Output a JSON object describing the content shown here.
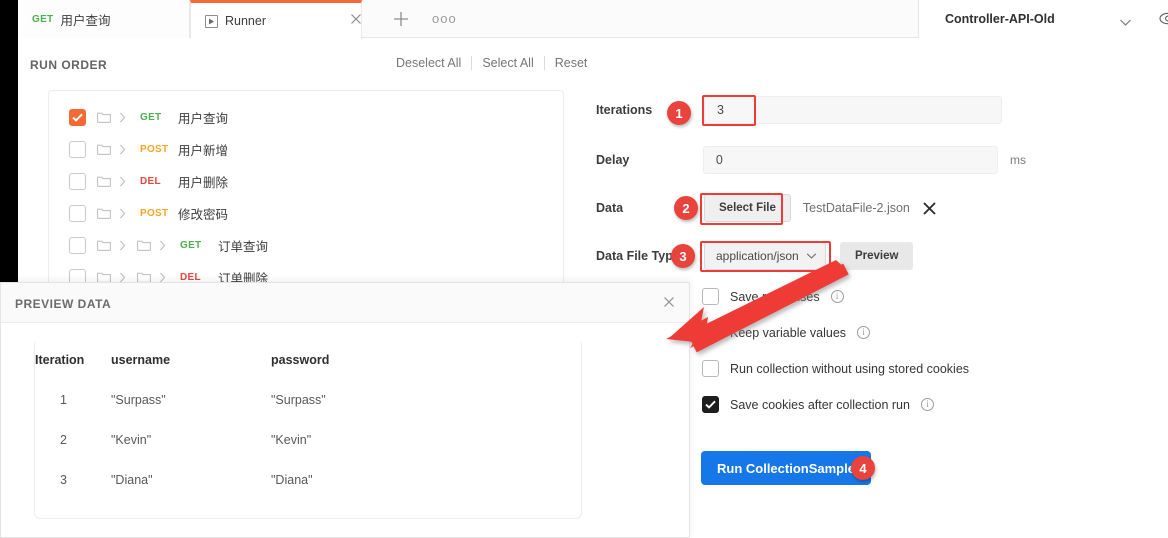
{
  "window": {
    "env_name": "Controller-API-Old",
    "accent_orange": "#f26b35",
    "accent_blue": "#1677e8",
    "annotation_red": "#e8433c"
  },
  "tabs": [
    {
      "method": "GET",
      "label": "用户查询",
      "active": false
    },
    {
      "method": "",
      "label": "Runner",
      "active": true
    }
  ],
  "tabbar": {
    "add_tab_label": "+",
    "more_label": "ooo",
    "close_label": "×"
  },
  "run_order": {
    "title": "RUN ORDER",
    "actions": [
      "Deselect All",
      "Select All",
      "Reset"
    ],
    "items": [
      {
        "checked": true,
        "depth": 1,
        "method": "GET",
        "name": "用户查询"
      },
      {
        "checked": false,
        "depth": 1,
        "method": "POST",
        "name": "用户新增"
      },
      {
        "checked": false,
        "depth": 1,
        "method": "DEL",
        "name": "用户删除"
      },
      {
        "checked": false,
        "depth": 1,
        "method": "POST",
        "name": "修改密码"
      },
      {
        "checked": false,
        "depth": 2,
        "method": "GET",
        "name": "订单查询"
      },
      {
        "checked": false,
        "depth": 2,
        "method": "DEL",
        "name": "订单删除"
      }
    ]
  },
  "settings": {
    "iterations": {
      "label": "Iterations",
      "value": "3"
    },
    "delay": {
      "label": "Delay",
      "value": "0",
      "unit": "ms"
    },
    "data": {
      "label": "Data",
      "select_file_button": "Select File",
      "filename": "TestDataFile-2.json",
      "clear_label": "✕"
    },
    "data_file_type": {
      "label": "Data File Type",
      "value": "application/json",
      "preview_button": "Preview"
    },
    "options": [
      {
        "label": "Save responses",
        "checked": false,
        "info": true
      },
      {
        "label": "Keep variable values",
        "checked": true,
        "info": true
      },
      {
        "label": "Run collection without using stored cookies",
        "checked": false,
        "info": false
      },
      {
        "label": "Save cookies after collection run",
        "checked": true,
        "info": true
      }
    ],
    "run_button": "Run CollectionSample"
  },
  "preview_panel": {
    "title": "PREVIEW DATA",
    "close_label": "×",
    "columns": [
      "Iteration",
      "username",
      "password"
    ],
    "rows": [
      [
        "1",
        "\"Surpass\"",
        "\"Surpass\""
      ],
      [
        "2",
        "\"Kevin\"",
        "\"Kevin\""
      ],
      [
        "3",
        "\"Diana\"",
        "\"Diana\""
      ]
    ]
  },
  "annotations": {
    "badges": [
      "1",
      "2",
      "3",
      "4"
    ]
  }
}
